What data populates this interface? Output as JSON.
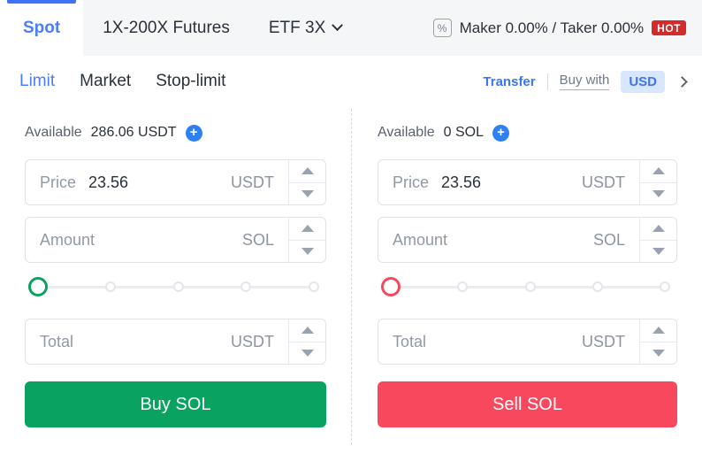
{
  "header": {
    "tabs": [
      {
        "label": "Spot",
        "active": true
      },
      {
        "label": "1X-200X Futures",
        "active": false
      },
      {
        "label": "ETF 3X",
        "active": false,
        "caret": true
      }
    ],
    "fee_icon": "percent-icon",
    "fee_text": "Maker 0.00% / Taker 0.00%",
    "hot_badge": "HOT"
  },
  "toolbar": {
    "order_tabs": [
      {
        "label": "Limit",
        "active": true
      },
      {
        "label": "Market",
        "active": false
      },
      {
        "label": "Stop-limit",
        "active": false
      }
    ],
    "transfer_label": "Transfer",
    "buy_with_label": "Buy with",
    "currency": "USD",
    "chevron": "chevron-right-icon"
  },
  "buy": {
    "available_label": "Available",
    "available_value": "286.06 USDT",
    "add_funds": "+",
    "price": {
      "label": "Price",
      "value": "23.56",
      "unit": "USDT",
      "placeholder": "Price"
    },
    "amount": {
      "label": "Amount",
      "value": "",
      "unit": "SOL",
      "placeholder": "Amount"
    },
    "total": {
      "label": "Total",
      "value": "",
      "unit": "USDT",
      "placeholder": "Total"
    },
    "slider": {
      "percent": 0,
      "steps": [
        "0%",
        "25%",
        "50%",
        "75%",
        "100%"
      ],
      "color": "#0aa260"
    },
    "submit_label": "Buy SOL",
    "submit_color": "#0aa260"
  },
  "sell": {
    "available_label": "Available",
    "available_value": "0 SOL",
    "add_funds": "+",
    "price": {
      "label": "Price",
      "value": "23.56",
      "unit": "USDT",
      "placeholder": "Price"
    },
    "amount": {
      "label": "Amount",
      "value": "",
      "unit": "SOL",
      "placeholder": "Amount"
    },
    "total": {
      "label": "Total",
      "value": "",
      "unit": "USDT",
      "placeholder": "Total"
    },
    "slider": {
      "percent": 0,
      "steps": [
        "0%",
        "25%",
        "50%",
        "75%",
        "100%"
      ],
      "color": "#f8485e"
    },
    "submit_label": "Sell SOL",
    "submit_color": "#f8485e"
  },
  "colors": {
    "accent_blue": "#3d73f5",
    "buy_green": "#0aa260",
    "sell_red": "#f8485e",
    "hot_red": "#d32b2b",
    "header_bg": "#f5f6f8"
  }
}
